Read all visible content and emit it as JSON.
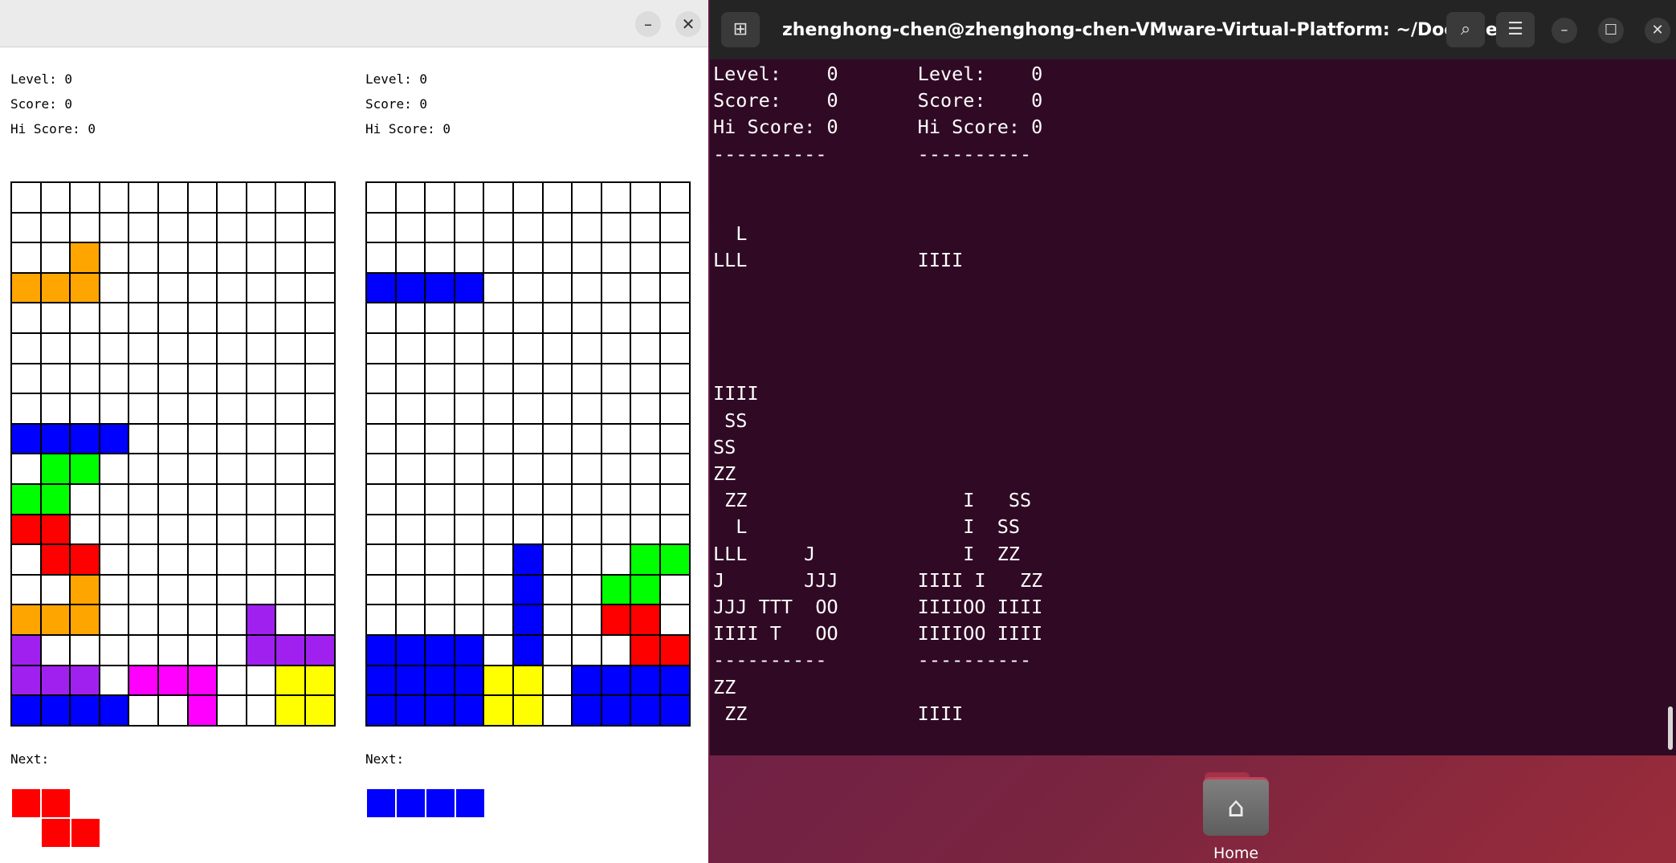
{
  "colors": {
    "orange": "#ffa500",
    "blue": "#0000ff",
    "green": "#00ff00",
    "red": "#ff0000",
    "purple": "#a020f0",
    "magenta": "#ff00ff",
    "yellow": "#ffff00",
    "empty": "#ffffff"
  },
  "tetris_window": {
    "minimize_icon": "–",
    "close_icon": "✕",
    "players": [
      {
        "level": "Level: 0",
        "score": "Score: 0",
        "hi_score": "Hi Score: 0",
        "next_label": "Next:",
        "board": [
          "...........",
          "...........",
          "..O........",
          "OOO........",
          "...........",
          "...........",
          "...........",
          "...........",
          "BBBB.......",
          ".GG........",
          "GG.........",
          "RR.........",
          ".RR........",
          "..O........",
          "OOO.....P..",
          "P.......PPP",
          "PPP.MMM..YY",
          "BBBB..M..YY"
        ],
        "next_piece": [
          "RR..",
          ".RR."
        ]
      },
      {
        "level": "Level: 0",
        "score": "Score: 0",
        "hi_score": "Hi Score: 0",
        "next_label": "Next:",
        "board": [
          "...........",
          "...........",
          "...........",
          "BBBB.......",
          "...........",
          "...........",
          "...........",
          "...........",
          "...........",
          "...........",
          "...........",
          "...........",
          ".....B...GG",
          ".....B..GG.",
          ".....B..RR.",
          "BBBB.B...RR",
          "BBBBYY.BBBB",
          "BBBBYY.BBBB"
        ],
        "next_piece": [
          "BBBB",
          "...."
        ]
      }
    ]
  },
  "terminal": {
    "new_tab_icon": "⊞",
    "title": "zhenghong-chen@zhenghong-chen-VMware-Virtual-Platform: ~/Docume...",
    "search_icon": "⌕",
    "menu_icon": "☰",
    "minimize_icon": "–",
    "maximize_icon": "☐",
    "close_icon": "✕",
    "output_lines": [
      "Level:    0       Level:    0",
      "Score:    0       Score:    0",
      "Hi Score: 0       Hi Score: 0",
      "----------        ----------",
      "",
      "",
      "  L",
      "LLL               IIII",
      "",
      "",
      "",
      "",
      "IIII",
      " SS",
      "SS",
      "ZZ",
      " ZZ                   I   SS",
      "  L                   I  SS",
      "LLL     J             I  ZZ",
      "J       JJJ       IIII I   ZZ",
      "JJJ TTT  OO       IIIIOO IIII",
      "IIII T   OO       IIIIOO IIII",
      "----------        ----------",
      "ZZ",
      " ZZ               IIII"
    ]
  },
  "dock": {
    "home_icon": "⌂",
    "home_label": "Home"
  }
}
